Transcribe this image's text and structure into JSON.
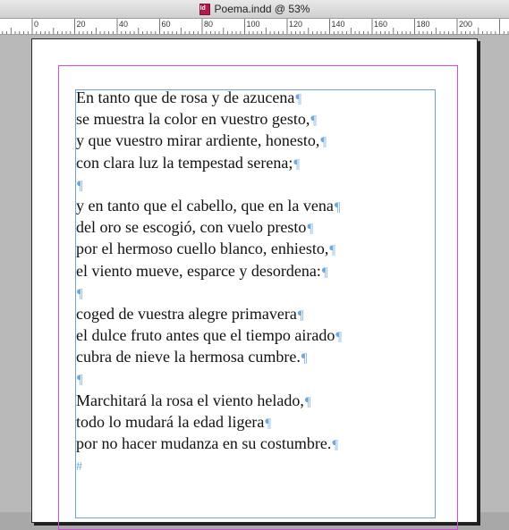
{
  "window": {
    "title": "Poema.indd @ 53%",
    "doc_icon": "indesign-doc-icon"
  },
  "ruler": {
    "labels": [
      "0",
      "20",
      "40",
      "60",
      "80",
      "100",
      "120",
      "140",
      "160",
      "180",
      "200"
    ]
  },
  "marks": {
    "paragraph": "¶",
    "end_of_story": "#"
  },
  "poem": {
    "lines": [
      "En tanto que de rosa y de azucena",
      "se muestra la color en vuestro gesto,",
      "y que vuestro mirar ardiente, honesto,",
      "con clara luz la tempestad serena;",
      "",
      "y en tanto que el cabello, que en la vena",
      "del oro se escogió, con vuelo presto",
      "por el hermoso cuello blanco, enhiesto,",
      "el viento mueve, esparce y desordena:",
      "",
      "coged de vuestra alegre primavera",
      "el dulce fruto antes que el tiempo airado",
      "cubra de nieve la hermosa cumbre.",
      "",
      "Marchitará la rosa el viento helado,",
      "todo lo mudará la edad ligera",
      "por no hacer mudanza en su costumbre."
    ]
  }
}
